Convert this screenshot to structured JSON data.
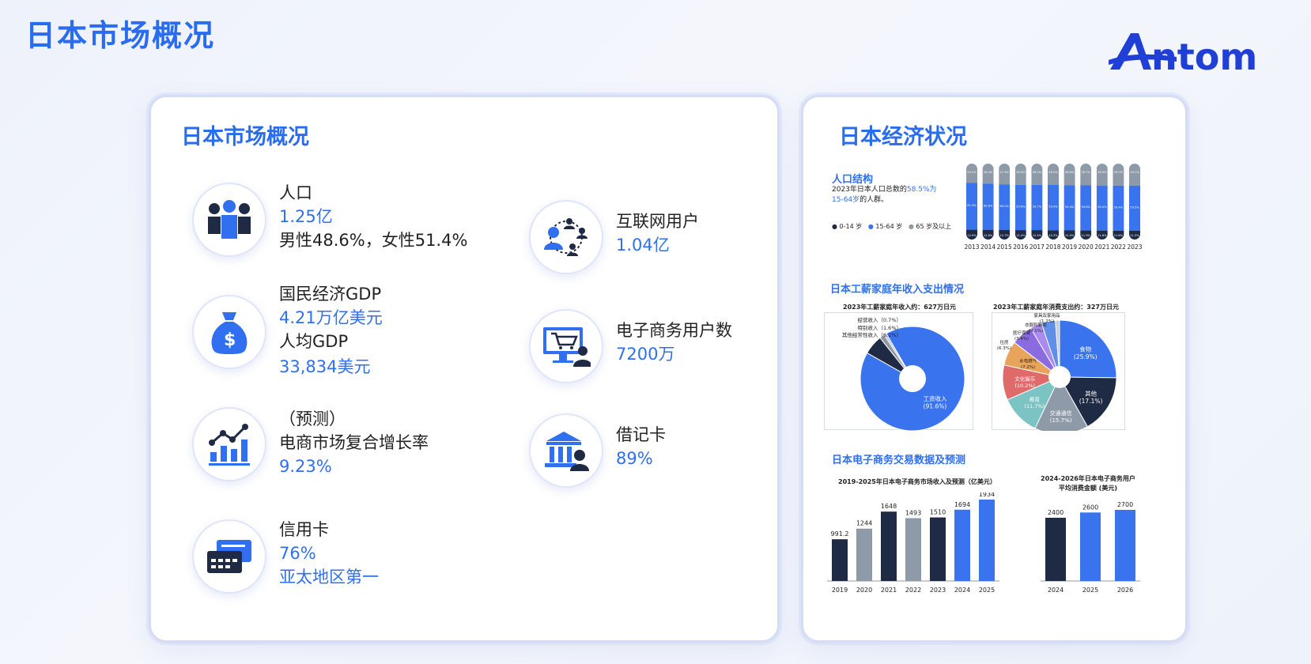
{
  "page": {
    "title": "日本市场概况"
  },
  "logo": {
    "text": "Antom"
  },
  "left_card": {
    "title": "日本市场概况",
    "stats": {
      "population": {
        "label": "人口",
        "value": "1.25亿",
        "detail": "男性48.6%，女性51.4%",
        "icon": "people-icon"
      },
      "gdp": {
        "label": "国民经济GDP",
        "value": "4.21万亿美元",
        "label2": "人均GDP",
        "value2": "33,834美元",
        "icon": "money-bag-icon"
      },
      "growth": {
        "label": "（预测）",
        "label2": "电商市场复合增长率",
        "value": "9.23%",
        "icon": "growth-chart-icon"
      },
      "credit": {
        "label": "信用卡",
        "value": "76%",
        "detail": "亚太地区第一",
        "icon": "credit-card-icon"
      },
      "internet": {
        "label": "互联网用户",
        "value": "1.04亿",
        "icon": "network-users-icon"
      },
      "ecommerce": {
        "label": "电子商务用户数",
        "value": "7200万",
        "icon": "shopping-cart-icon"
      },
      "debit": {
        "label": "借记卡",
        "value": "89%",
        "icon": "bank-icon"
      }
    }
  },
  "right_card": {
    "title": "日本经济状况",
    "population_structure": {
      "title": "人口结构",
      "desc_part1": "2023年日本人口总数的",
      "desc_highlight1": "58.5%为",
      "desc_highlight2": "15-64岁",
      "desc_part2": "的人群。",
      "legend": [
        "0-14 岁",
        "15-64 岁",
        "65 岁及以上"
      ]
    },
    "household": {
      "title": "日本工薪家庭年收入支出情况",
      "income_title": "2023年工薪家庭年收入约：627万日元",
      "expense_title": "2023年工薪家庭年消费支出约：327万日元"
    },
    "ecommerce": {
      "title": "日本电子商务交易数据及预测",
      "revenue_title": "2019-2025年日本电子商务市场收入及预测（亿美元）",
      "spend_title_1": "2024-2026年日本电子商务用户",
      "spend_title_2": "平均消费金额 (美元)"
    }
  },
  "colors": {
    "accent": "#2f6ff0",
    "dark": "#1f2a44",
    "gray": "#8e9aa8",
    "blue": "#3a73ee"
  },
  "chart_data": [
    {
      "type": "bar",
      "stacked": true,
      "title": "人口结构",
      "categories": [
        "2013",
        "2014",
        "2015",
        "2016",
        "2017",
        "2018",
        "2019",
        "2020",
        "2021",
        "2022",
        "2023"
      ],
      "series": [
        {
          "name": "0-14 岁",
          "values": [
            12.9,
            12.8,
            12.7,
            12.4,
            12.4,
            12.2,
            12.0,
            11.9,
            11.8,
            11.6,
            11.5
          ]
        },
        {
          "name": "15-64 岁",
          "values": [
            61.9,
            60.8,
            60.0,
            59.6,
            59.7,
            59.9,
            59.4,
            59.6,
            59.4,
            59.4,
            59.5
          ]
        },
        {
          "name": "65 岁及以上",
          "values": [
            25.2,
            26.4,
            27.3,
            28.0,
            28.0,
            28.2,
            28.6,
            28.7,
            28.9,
            29.0,
            29.1
          ]
        }
      ]
    },
    {
      "type": "pie",
      "title": "2023年工薪家庭年收入约：627万日元",
      "slices": [
        {
          "label": "工资收入",
          "value": 91.6
        },
        {
          "label": "其他经常性收入",
          "value": 6.1
        },
        {
          "label": "特别收入",
          "value": 1.6
        },
        {
          "label": "经营收入",
          "value": 0.7
        }
      ]
    },
    {
      "type": "pie",
      "title": "2023年工薪家庭年消费支出约：327万日元",
      "slices": [
        {
          "label": "食物",
          "value": 25.9
        },
        {
          "label": "其他",
          "value": 17.1
        },
        {
          "label": "交通通信",
          "value": 15.7
        },
        {
          "label": "教育",
          "value": 11.7
        },
        {
          "label": "文化娱乐",
          "value": 10.2
        },
        {
          "label": "水电燃气",
          "value": 7.2
        },
        {
          "label": "住房",
          "value": 6.3
        },
        {
          "label": "医疗保健",
          "value": 3.4
        },
        {
          "label": "衣服和鞋类",
          "value": 4.1
        },
        {
          "label": "家具及家用品",
          "value": 1.2
        }
      ]
    },
    {
      "type": "bar",
      "title": "2019-2025年日本电子商务市场收入及预测（亿美元）",
      "categories": [
        "2019",
        "2020",
        "2021",
        "2022",
        "2023",
        "2024",
        "2025"
      ],
      "values": [
        991.2,
        1244,
        1648,
        1493,
        1510,
        1694,
        1934
      ],
      "colors": [
        "#1f2a44",
        "#8e9aa8",
        "#1f2a44",
        "#8e9aa8",
        "#1f2a44",
        "#3a73ee",
        "#3a73ee"
      ]
    },
    {
      "type": "bar",
      "title": "2024-2026年日本电子商务用户平均消费金额 (美元)",
      "categories": [
        "2024",
        "2025",
        "2026"
      ],
      "values": [
        2400,
        2600,
        2700
      ],
      "colors": [
        "#1f2a44",
        "#3a73ee",
        "#3a73ee"
      ]
    }
  ]
}
